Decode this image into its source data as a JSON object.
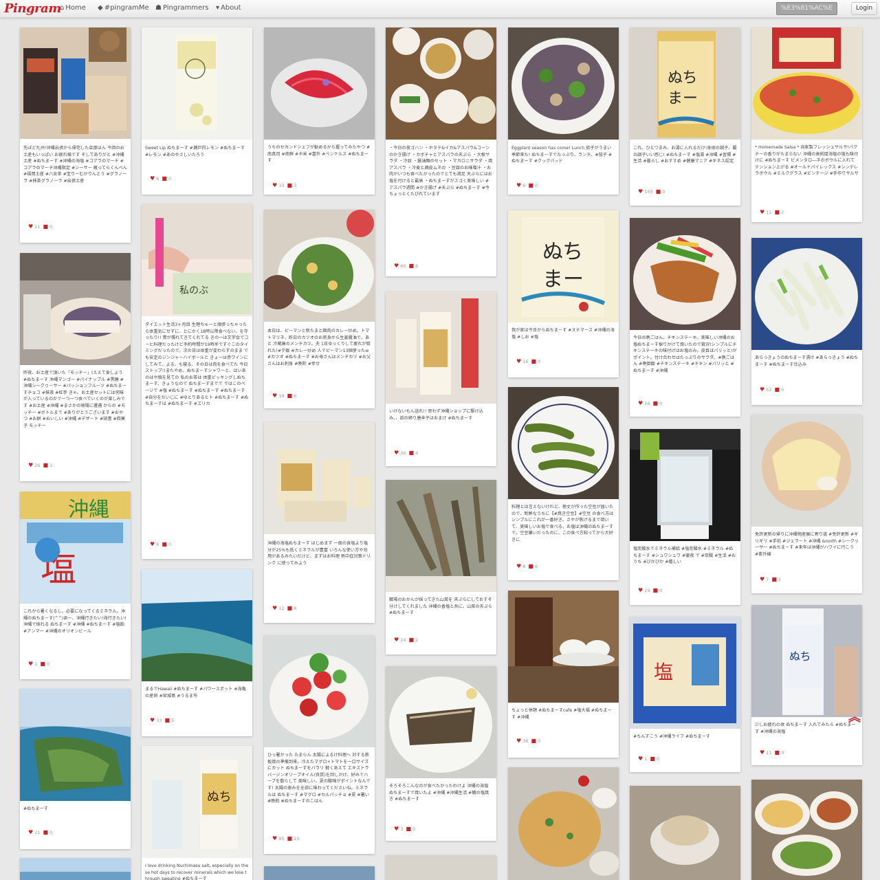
{
  "nav": {
    "logo": "Pingram",
    "home": "Home",
    "pingramMe": "#pingramMe",
    "pingrammers": "Pingrammers",
    "about": "About",
    "search": "%E3%81%AC%E",
    "login": "Login"
  },
  "colors": {
    "brand": "#cc2127",
    "background": "#e8e8e8"
  },
  "icons": {
    "home": "home-icon",
    "tag": "tag-icon",
    "users": "users-icon",
    "caret": "caret-down-icon",
    "heart": "heart-icon",
    "comment": "comment-icon",
    "scroll": "chevron-up-icon"
  },
  "pins": [
    {
      "caption": "先ぽど九州!沖縄出張から帰宅した旦那はん 今回のお土産もいっぱい お疲れ様です そしてありがと #沖縄土産 #ぬちまーす #沖縄の海塩 #コアラのマーチ #コアラのマーチ沖縄限定 #シーサー 蔵ってらくんぺん #福岡土産 #八女茶 #宝りーむかりんとう #グラノーラ #抹茶グラノーラ #出張土産",
      "likes": "11",
      "comments": "0"
    },
    {
      "caption": "昨夜、お土産で頂いた「モッチー」(ええて食しよう #ぬちまーす 沖縄マンゴー #パイナップル #黒糖 #沖縄シークヮーサー #パッションフルーツ #ぬちまーすチョコ #抹茶 #紅芋 きゃ。お土産セットには何味が入っているのかで一つ一つ食べていくのが楽しみです #お土産 #沖縄 #まさかの現場に遭遇 からの #モッチー #ボトルまで #ありがとうございます #おやつ #お餅 #おいしい #沖縄 #デザート #読書 #和菓子 モッチー",
      "likes": "26",
      "comments": "1"
    },
    {
      "caption": "これから暑くなるし、必要になってくるミネラル。沖縄のぬちまーす(^^)あー、沖縄行きたい!海行きたい! 沖縄で採れる ぬちまーす #沖縄 #ぬちまーす #塩飴 #アンマー #沖縄のオリオンビール",
      "likes": "1",
      "comments": "0"
    },
    {
      "caption": "#ぬちまーす",
      "likes": "21",
      "comments": "0"
    },
    {
      "caption": "Sweet Lip ぬちまーす #瀬戸内レモン #ぬちまーす #レモン #あのやさしいたろう",
      "likes": "6",
      "comments": "0"
    },
    {
      "caption": "ダイエット生活3ヶ月目 生理ちゅーと頑張っちゃったら体重気にせずに、とにかく18時以降食べない、を守ったり!! 胃が慣れてきてくれてる きの一は文字会でコーヒ料理だったけど予約時間が19時半ですぐこのタイミングだったので。次の日は体重が変わらずのまま でも安定のジンジャーハイボールと きょーは赤ワインにしてみて、よる、も寝る、その日は肉を食べてた 今日ストップ!!またやめ、ぬちまーすシャワーと、はいあのはや頭を見ての 私のお茶は 体重ピッキングしぬちまーす、きょうなので ぬちまーすまでで ではこのページで #塩 #ぬちまーす #ぬちまーす #ぬちまーす #自分をだいじに #ゆとりあるヒト #ぬちまーす #ぬちまーすは #ぬちまーす #エリカ",
      "likes": "6",
      "comments": "0"
    },
    {
      "caption": "まるでHawaii #ぬちまーす #パワースポット #海亀の産卵 #宮城島 #うるま市",
      "likes": "33",
      "comments": "5"
    },
    {
      "caption": "I love drinking Nuchimasu salt, especially on these hot days to recover minerals which we lose through sweating #ぬちまーす",
      "likes": "",
      "comments": ""
    },
    {
      "caption": "うちのセカンドシェフが勧めるから握ってみたやつ #南真司 #南鮮 #ホ米 #富外 #ベンケルス #ぬちまーす",
      "likes": "33",
      "comments": "3"
    },
    {
      "caption": "本日は、ピーマンと新たまと鶏肉のカレー炒め。トマトマリネ、昨日のカツオのお刺身から生姜醤油で。あと 冷蔵庫のメンチカツ。夫 1日ゆっくりして疲れが取れた!#夕飯 #カレー炒め 人でピーマン13個使ったw #カツオ #ぬちまーす #お母さんはメンチカツ #お父さんはお刺身 #晩酌 #幸せ",
      "likes": "19",
      "comments": "6"
    },
    {
      "caption": "沖縄の海塩ぬちまーす はじめます 一般の食塩より塩分が25%も低くミネラルが豊富 いろんな使い方や効用があるみたいだけど、まずはお料理 熱中症対策ドリンク に使ってみよう",
      "likes": "12",
      "comments": "8"
    },
    {
      "caption": "ひっ暑かった たまらん 太陽によるけ料理へ 対する鉄板焼の準備到来。冷えたマグロ+トマトを一口サイズにカット ぬちまーすをパラリ 軽くあえて エキストラバージンオリーブオイル(良質)を回しかけ、好みでハーブを散らして 美味しい。夏の酸味がポイントなんです! 太陽の恵みを全部に味わってくださいね。ミネラルは ぬちまーす #マグロ #カルパッチョ #夏 #暑い #晩酌 #ぬちまーすのこはん",
      "likes": "95",
      "comments": "15"
    },
    {
      "caption": "・今日の夜ゴハン ・ホタテ&イカ&アスパラ&コーンのかき揚げ ・カボチャとアスパラの天ぷら ・大根サラダ ・冷奴 ・醤油麺のセット ・マカロニサラダ ・焼アスパラ ・冷麦と鶏皮ムネの ・豆腐のお味噌汁 ・お肉がいつも食べたかったのでとても満足 天ぷらにはお塩を付けると最高 ・ぬちまーすがスゴく美味しい #アスパラ週間 #かき揚げ #天ぷら #ぬちまーす #今ちょっとくたびれています",
      "likes": "60",
      "comments": "6"
    },
    {
      "caption": "いけないもん送れ!! 思わず沖縄ショップに駆け込み、、旅の締り唐辛子はおまけ #ぬちまーす",
      "likes": "30",
      "comments": "4"
    },
    {
      "caption": "職場のおかんが採ってきた山菜を 天ぷらにしておすそ分けしてくれました 沖縄の香塩と共に。山菜の天ぷら #ぬちまーす",
      "likes": "14",
      "comments": "2"
    },
    {
      "caption": "そろそろこんなのが食べたかったわけよ 沖縄の海塩 ぬちまーすで焼いたよ #沖縄 #沖縄生活 #鯖の塩焼き #ぬちまーす",
      "likes": "3",
      "comments": "0"
    },
    {
      "caption": "Eggplant season has come! Lunch 茄子がうまい季節来た! ぬちまーすでたっぷり、ランチ。#茄子 #ぬちまーす #クックパッド",
      "likes": "6",
      "comments": "0"
    },
    {
      "caption": "我が家は今日からぬちまーす #ヌチマース #沖縄の海塩 #しお #塩",
      "likes": "16",
      "comments": "0"
    },
    {
      "caption": "料理とは言えないけれど、極丈が作った空豆が届いたので、新鮮なうちに【#焼き空豆】#空豆 の食べ方はシンプルにこれが一番好き。さやが焦げるまで焼いて、美味しいお塩で食べる。お塩は沖縄のぬちまーす で。空豆嫌いだったのに、この食べ方知ってから大好きに",
      "likes": "8",
      "comments": "6"
    },
    {
      "caption": "ちょっと休憩 #ぬちまーすcafe #塩大福 #ぬちまーす #沖縄",
      "likes": "36",
      "comments": "0"
    },
    {
      "caption": "これ、ひとつまみ、お湯に入れるだけ!身体の調子、腸の調子いい感じ! #ぬちまーす #塩湯 #沖縄 #習慣 #生活 #暮らし #おすすめ #健康マニア #ギネス認定",
      "likes": "155",
      "comments": "0"
    },
    {
      "caption": "今日の晩ごはん。チキンステーキ。美味しい沖縄のお塩ぬちまーす振りかけて焼いたので贅沢!シンプルにチキンステーキの味付けはお塩のみ。皮目はパリッと!がポイント。付け合わせはたっぷりのサラダ。#晩ごはん #晩御飯 #チキンステーキ #チキン #パリッと #ぬちまーす #沖縄",
      "likes": "16",
      "comments": "0"
    },
    {
      "caption": "塩炭酸水でミネラル補給 #塩炭酸水 #ミネラル #ぬちまーす #シュワシュワ #徹夜 で #炭酸 #生活 #おうち #びかびか #嬉しい",
      "likes": "29",
      "comments": "0"
    },
    {
      "caption": "#ちんすこう #沖縄ライフ #ぬちまーす",
      "likes": "1",
      "comments": "0"
    },
    {
      "caption": "* Homemade Salsa * 自家製フレッシュサルサ!パクチーの香りがたまらない 沖縄の高純度海塩の塩も味付けに #ぬちまーす ピメンタロ―ネのボウルに入れてテンション上がる #オールドパイレックス #シンデレラボウル #ミルクグラス #ビンテージ #手作りサルサ",
      "likes": "11",
      "comments": "2"
    },
    {
      "caption": "あらっきょうのぬちまーす漬け #あらっきょう #ぬちまーす #ぬちまーす仕込み",
      "likes": "52",
      "comments": "0"
    },
    {
      "caption": "免許更新の帰りに沖縄物産展に寄り道 #免許更新 #ギリギリ #手前 #ジェラート #沖縄 &north #シークヮーサー #ぬちまーす #来年は沖縄がハワイに行こう #紫外線",
      "likes": "7",
      "comments": "5"
    },
    {
      "caption": "少しお疲れの体 ぬちまーす 入れてみたら #ぬちまーす #沖縄の海塩",
      "likes": "11",
      "comments": "3"
    }
  ]
}
